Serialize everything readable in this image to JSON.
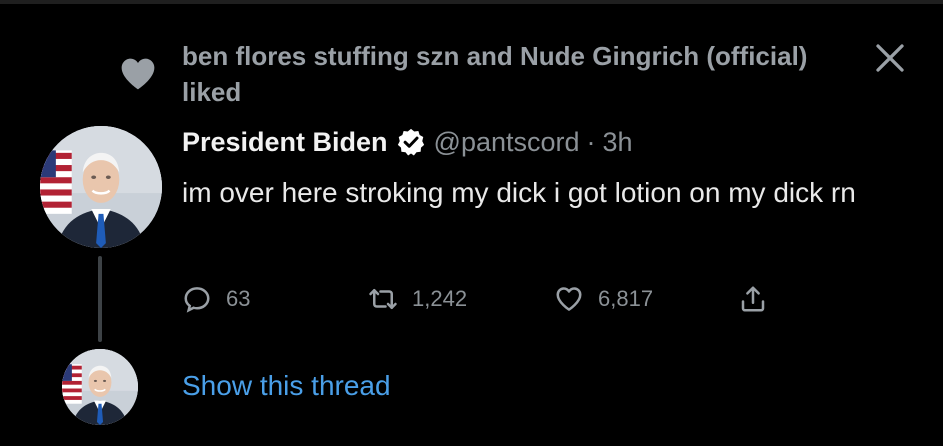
{
  "social_context": {
    "text": "ben flores stuffing szn and Nude Gingrich (official) liked",
    "icon": "heart-icon"
  },
  "close": {
    "icon": "close-icon"
  },
  "tweet": {
    "display_name": "President Biden",
    "verified_icon": "verified-badge-icon",
    "handle": "@pantscord",
    "separator": "·",
    "time": "3h",
    "text": "im over here stroking my dick i got lotion on my dick rn",
    "avatar": "profile-photo"
  },
  "actions": {
    "reply": {
      "icon": "reply-icon",
      "count": "63"
    },
    "retweet": {
      "icon": "retweet-icon",
      "count": "1,242"
    },
    "like": {
      "icon": "heart-outline-icon",
      "count": "6,817"
    },
    "share": {
      "icon": "share-icon"
    }
  },
  "thread": {
    "label": "Show this thread"
  },
  "colors": {
    "background": "#000000",
    "primary_text": "#e7e9ea",
    "secondary_text": "#8b9196",
    "link": "#4a9fe8",
    "verified_badge": "#ffffff"
  }
}
